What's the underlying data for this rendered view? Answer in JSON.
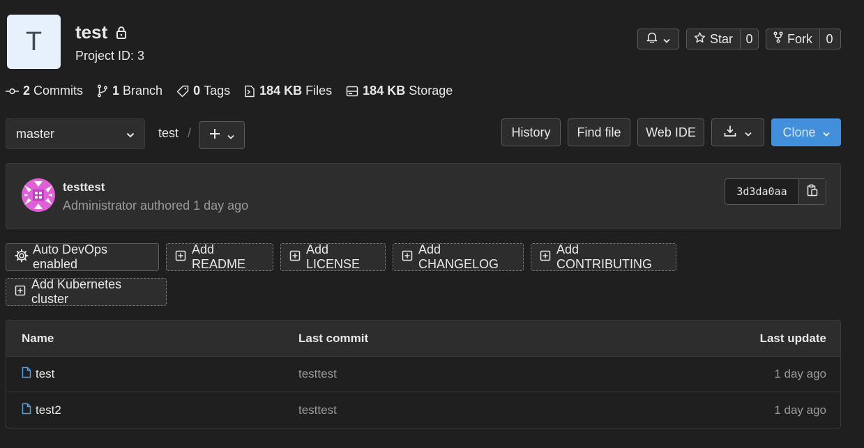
{
  "project": {
    "avatar_letter": "T",
    "name": "test",
    "project_id_label": "Project ID: 3"
  },
  "header_actions": {
    "star_label": "Star",
    "star_count": "0",
    "fork_label": "Fork",
    "fork_count": "0"
  },
  "stats": [
    {
      "value": "2",
      "label": "Commits",
      "icon": "commit-icon"
    },
    {
      "value": "1",
      "label": "Branch",
      "icon": "branch-icon"
    },
    {
      "value": "0",
      "label": "Tags",
      "icon": "tag-icon"
    },
    {
      "value": "184 KB",
      "label": "Files",
      "icon": "file-archive-icon"
    },
    {
      "value": "184 KB",
      "label": "Storage",
      "icon": "storage-icon"
    }
  ],
  "repo_nav": {
    "branch": "master",
    "breadcrumb": "test",
    "separator": "/",
    "history_label": "History",
    "find_file_label": "Find file",
    "web_ide_label": "Web IDE",
    "clone_label": "Clone"
  },
  "last_commit": {
    "title": "testtest",
    "meta": "Administrator authored 1 day ago",
    "sha": "3d3da0aa"
  },
  "quick_actions": {
    "auto_devops": "Auto DevOps enabled",
    "add_readme": "Add README",
    "add_license": "Add LICENSE",
    "add_changelog": "Add CHANGELOG",
    "add_contributing": "Add CONTRIBUTING",
    "add_kubernetes": "Add Kubernetes cluster"
  },
  "file_table": {
    "headers": {
      "name": "Name",
      "last_commit": "Last commit",
      "last_update": "Last update"
    },
    "rows": [
      {
        "name": "test",
        "last_commit": "testtest",
        "last_update": "1 day ago"
      },
      {
        "name": "test2",
        "last_commit": "testtest",
        "last_update": "1 day ago"
      }
    ]
  },
  "colors": {
    "background": "#1f1f1f",
    "panel": "#2d2d2d",
    "primary_button": "#428fdc",
    "file_icon": "#4f9ee8"
  }
}
